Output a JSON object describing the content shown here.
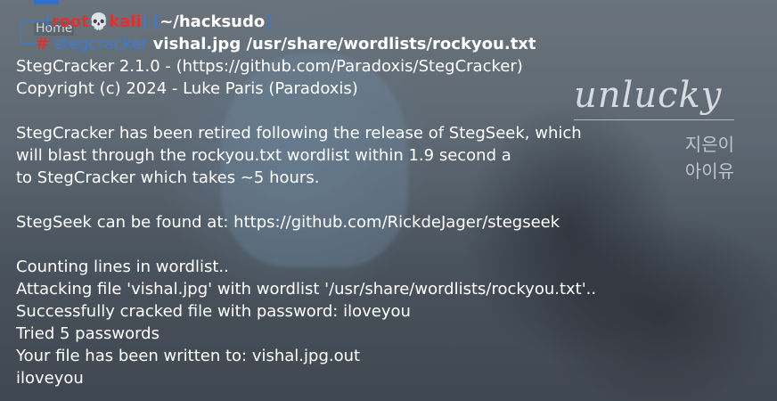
{
  "wallpaper": {
    "title": "unlucky",
    "sub1": "지은이",
    "sub2": "아이유"
  },
  "desktop": {
    "home_label": "Home"
  },
  "prompt": {
    "open_bracket": "┌──(",
    "user": "root",
    "skull": "💀",
    "host": "kali",
    "mid": ")-[",
    "cwd": "~/hacksudo",
    "close": "]",
    "second_prefix": "└─",
    "hash": "#",
    "command": "stegcracker",
    "args": "vishal.jpg /usr/share/wordlists/rockyou.txt"
  },
  "output": [
    "StegCracker 2.1.0 - (https://github.com/Paradoxis/StegCracker)",
    "Copyright (c) 2024 - Luke Paris (Paradoxis)",
    "",
    "StegCracker has been retired following the release of StegSeek, which",
    "will blast through the rockyou.txt wordlist within 1.9 second a",
    "to StegCracker which takes ~5 hours.",
    "",
    "StegSeek can be found at: https://github.com/RickdeJager/stegseek",
    "",
    "Counting lines in wordlist..",
    "Attacking file 'vishal.jpg' with wordlist '/usr/share/wordlists/rockyou.txt'..",
    "Successfully cracked file with password: iloveyou",
    "Tried 5 passwords",
    "Your file has been written to: vishal.jpg.out",
    "iloveyou"
  ],
  "colors": {
    "prompt_blue": "#3a7bd5",
    "prompt_red": "#e03131",
    "text": "#ffffff"
  }
}
